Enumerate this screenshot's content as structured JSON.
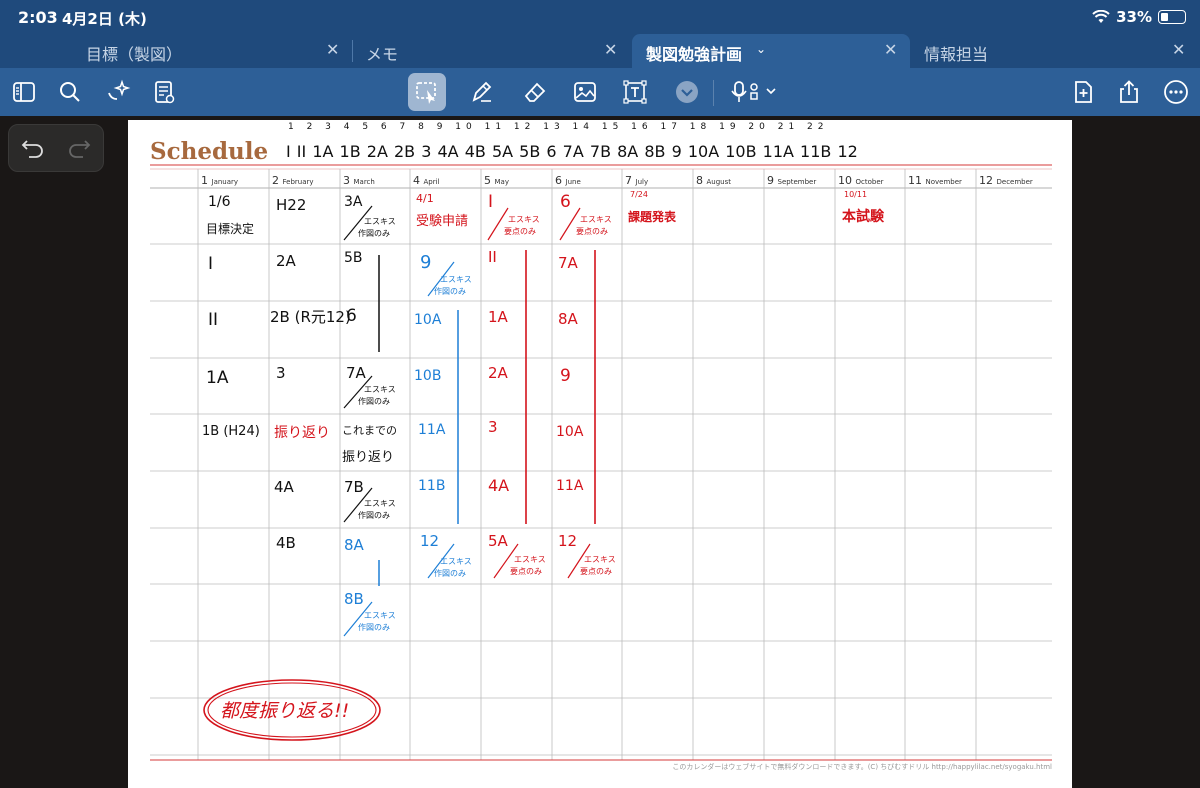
{
  "status": {
    "time": "2:03",
    "date": "4月2日 (木)",
    "battery": "33%"
  },
  "tabs": [
    {
      "label": "目標（製図）"
    },
    {
      "label": "メモ"
    },
    {
      "label": "製図勉強計画"
    },
    {
      "label": "情報担当"
    }
  ],
  "toolbar": {
    "icons": [
      "sidebar-icon",
      "search-icon",
      "sparkle-icon",
      "document-icon",
      "lasso-icon",
      "pen-icon",
      "eraser-icon",
      "image-icon",
      "textbox-icon",
      "chevron-down-icon",
      "microphone-icon",
      "add-page-icon",
      "share-icon",
      "more-icon"
    ]
  },
  "page": {
    "title": "Schedule",
    "top_numbers": "1  2  3  4  5  6  7  8  9  10  11  12 13  14  15  16  17  18  19  20  21  22",
    "top_units": "I  II  1A  1B  2A  2B  3  4A  4B  5A  5B  6  7A  7B  8A  8B  9  10A  10B  11A  11B  12",
    "months": [
      {
        "num": "1",
        "name": "January"
      },
      {
        "num": "2",
        "name": "February"
      },
      {
        "num": "3",
        "name": "March"
      },
      {
        "num": "4",
        "name": "April"
      },
      {
        "num": "5",
        "name": "May"
      },
      {
        "num": "6",
        "name": "June"
      },
      {
        "num": "7",
        "name": "July"
      },
      {
        "num": "8",
        "name": "August"
      },
      {
        "num": "9",
        "name": "September"
      },
      {
        "num": "10",
        "name": "October"
      },
      {
        "num": "11",
        "name": "November"
      },
      {
        "num": "12",
        "name": "December"
      }
    ],
    "footer": "このカレンダーはウェブサイトで無料ダウンロードできます。(C) ちびむすドリル http://happylilac.net/syogaku.html"
  },
  "notes": {
    "jan": [
      "1/6",
      "目標決定",
      "I",
      "II",
      "1A",
      "1B (H24)"
    ],
    "feb": [
      "H22",
      "2A",
      "2B (R元12)",
      "3",
      "振り返り",
      "4A",
      "4B"
    ],
    "mar": [
      "3A",
      "エスキス",
      "作図のみ",
      "5B",
      "6",
      "7A",
      "エスキス",
      "作図のみ",
      "これまでの",
      "振り返り",
      "7B",
      "エスキス",
      "作図のみ",
      "8A",
      "8B",
      "エスキス",
      "作図のみ"
    ],
    "apr": [
      "4/1",
      "受験申請",
      "9",
      "エスキス",
      "作図のみ",
      "10A",
      "10B",
      "11A",
      "11B",
      "12",
      "エスキス",
      "作図のみ"
    ],
    "may": [
      "I",
      "エスキス",
      "要点のみ",
      "II",
      "1A",
      "2A",
      "3",
      "4A",
      "5A",
      "エスキス",
      "要点のみ"
    ],
    "jun": [
      "6",
      "エスキス",
      "要点のみ",
      "7A",
      "8A",
      "9",
      "10A",
      "11A",
      "12",
      "エスキス",
      "要点のみ"
    ],
    "jul": [
      "7/24",
      "課題発表"
    ],
    "oct": [
      "10/11",
      "本試験"
    ],
    "bottom": "都度振り返る!!"
  }
}
